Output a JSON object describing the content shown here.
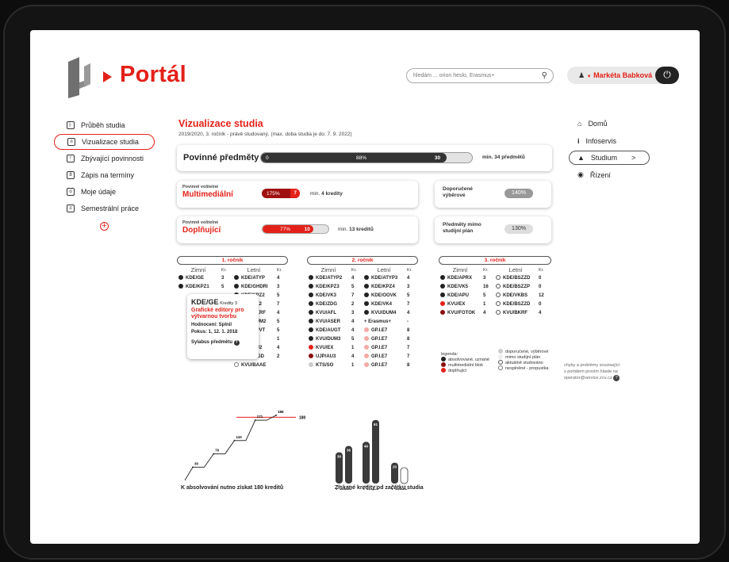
{
  "brand": {
    "name": "Portál"
  },
  "header": {
    "search_placeholder": "hledám ... orion heslo, Erasmus+",
    "user_name": "Markéta Babková"
  },
  "left_nav": [
    {
      "label": "Průběh studia",
      "icon": "chart-icon"
    },
    {
      "label": "Vizualizace studia",
      "icon": "document-icon",
      "active": true
    },
    {
      "label": "Zbývající povinnosti",
      "icon": "exclamation-icon"
    },
    {
      "label": "Zápis na termíny",
      "icon": "calendar-icon"
    },
    {
      "label": "Moje údaje",
      "icon": "id-card-icon"
    },
    {
      "label": "Semestrální práce",
      "icon": "paper-icon"
    }
  ],
  "right_nav": [
    {
      "label": "Domů",
      "icon": "home-icon"
    },
    {
      "label": "Infoservis",
      "icon": "info-icon"
    },
    {
      "label": "Studium",
      "icon": "graduation-cap-icon",
      "chevron": ">"
    },
    {
      "label": "Řízení",
      "icon": "radio-icon"
    }
  ],
  "main": {
    "title": "Vizualizace studia",
    "subtitle": "2019/2020, 3. ročník - právě studovaný, (max. doba studia je do: 7. 9. 2022)",
    "povinne": {
      "label": "Povinné předměty",
      "start": "0",
      "percent": "88%",
      "current": "30",
      "fill": 0.88,
      "note": "min. 34 předmětů"
    },
    "multimedialni": {
      "small": "Povinně volitelné",
      "label": "Multimediální",
      "percent": "175%",
      "value": "7",
      "note_prefix": "min.",
      "note_bold": "4 kredity"
    },
    "doplnujici": {
      "small": "Povinně volitelné",
      "label": "Doplňující",
      "percent": "77%",
      "value": "10",
      "fill": 0.77,
      "note_prefix": "min.",
      "note_bold": "13 kreditů"
    },
    "doporucene": {
      "label": "Doporučené výběrové",
      "percent": "140%"
    },
    "mimo": {
      "label": "Předměty mimo studijní plán",
      "percent": "130%"
    }
  },
  "years": [
    {
      "title": "1. ročník",
      "headers": [
        "Zimní",
        "Kr.",
        "Letní",
        "Kr."
      ],
      "rows": [
        [
          "KDE/GE",
          "3",
          "KDE/ATYP",
          "4"
        ],
        [
          "KDE/KPZ1",
          "5",
          "KDE/GHDRI",
          "3"
        ],
        [
          "",
          "",
          "KDE/KPZ2",
          "5"
        ],
        [
          "",
          "",
          "KDE/VK2",
          "7"
        ],
        [
          "",
          "",
          "KDE/AKRF",
          "4"
        ],
        [
          "",
          "",
          "KDE/DUM2",
          "5"
        ],
        [
          "",
          "",
          "KDE/BPVT",
          "5"
        ],
        [
          "",
          "",
          "KVU/EX",
          "1"
        ],
        [
          "",
          "",
          "KVU/AU2",
          "4"
        ],
        [
          "",
          "",
          "KDE/WGD",
          "2"
        ],
        [
          "",
          "",
          "KVU/BAAE",
          ""
        ]
      ]
    },
    {
      "title": "2. ročník",
      "headers": [
        "Zimní",
        "Kr.",
        "Letní",
        "Kr."
      ],
      "rows": [
        [
          "KDE/ATYP2",
          "4",
          "KDE/ATYP3",
          "4"
        ],
        [
          "KDE/KPZ3",
          "5",
          "KDE/KPZ4",
          "3"
        ],
        [
          "KDE/VK3",
          "7",
          "KDE/OOVK",
          "5"
        ],
        [
          "KDE/ZDG",
          "2",
          "KDE/VK4",
          "7"
        ],
        [
          "KVU/AFL",
          "3",
          "KVU/DUM4",
          "4"
        ],
        [
          "KVU/ASER",
          "4",
          "+ Erasmus+",
          "-"
        ],
        [
          "KDE/AUGT",
          "4",
          "GP.I.E7",
          "8"
        ],
        [
          "KVU/DUM3",
          "5",
          "GP.I.E7",
          "8"
        ],
        [
          "KVU/EX",
          "1",
          "GP.I.E7",
          "7"
        ],
        [
          "UJP/AU3",
          "4",
          "GP.I.E7",
          "7"
        ],
        [
          "KTS/SO",
          "1",
          "GP.I.E7",
          "8"
        ]
      ]
    },
    {
      "title": "3. ročník",
      "headers": [
        "Zimní",
        "Kr.",
        "Letní",
        "Kr."
      ],
      "rows": [
        [
          "KDE/APRX",
          "3",
          "KDE/BSZZD",
          "0"
        ],
        [
          "KDE/VK5",
          "16",
          "KDE/BSZZP",
          "0"
        ],
        [
          "KDE/APU",
          "5",
          "KDE/VKBS",
          "12"
        ],
        [
          "KVU/EX",
          "1",
          "KDE/BSZZD",
          "0"
        ],
        [
          "KVU/FOTOK",
          "4",
          "KVU/BKRF",
          "4"
        ]
      ]
    }
  ],
  "tooltip": {
    "code": "KDE/GE",
    "credits": "Kredity 3",
    "name": "Grafické editory pro výtvarnou tvorbu",
    "grade": "Hodnocení: Splnil",
    "attempt": "Pokus: 1, 12. 1. 2018",
    "link": "Sylabus předmětu"
  },
  "legend": {
    "title": "legenda:",
    "items_left": [
      "absolvované, uznané",
      "multimediální blok",
      "doplňující"
    ],
    "items_right": [
      "doporučené, výběrové",
      "mimo studijní plán",
      "aktuálně studováno",
      "nesplněné - propustka"
    ]
  },
  "contact": {
    "line1": "chyby a problémy související",
    "line2": "s portálem prosím hlaste na",
    "line3": "operator@service.zcu.cz"
  },
  "chart_data": [
    {
      "type": "line",
      "title": "K absolvování nutno získat 180 kreditů",
      "points": [
        {
          "label": "30",
          "value": 30
        },
        {
          "label": "70",
          "value": 70
        },
        {
          "label": "110",
          "value": 110
        },
        {
          "label": "171",
          "value": 171
        },
        {
          "label": "186",
          "value": 186
        }
      ],
      "target": {
        "label": "180",
        "value": 180
      },
      "ylim": [
        0,
        200
      ]
    },
    {
      "type": "bar",
      "title": "Získané kredity od začátku studia",
      "categories": [
        "ZS",
        "LS",
        "ZS",
        "LS",
        "ZS",
        "LS"
      ],
      "groups": [
        "1. ročník",
        "2. ročník",
        "3. ročník"
      ],
      "values": [
        30,
        36,
        40,
        61,
        20,
        0
      ],
      "value_labels": [
        "30",
        "36",
        "40",
        "61",
        "20",
        ""
      ],
      "ylim": [
        0,
        70
      ]
    }
  ]
}
